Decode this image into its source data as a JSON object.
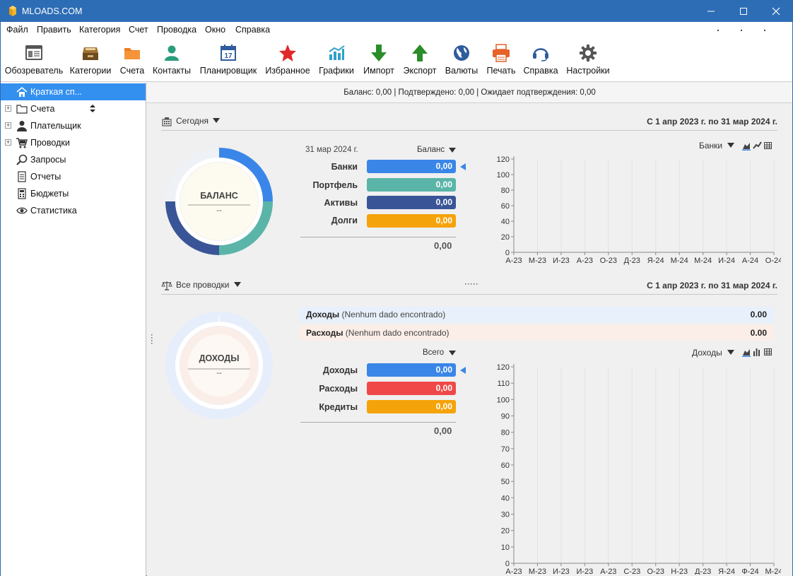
{
  "window": {
    "title": "MLOADS.COM"
  },
  "menu": [
    "Файл",
    "Править",
    "Категория",
    "Счет",
    "Проводка",
    "Окно",
    "Справка"
  ],
  "toolbar": [
    {
      "label": "Обозреватель",
      "icon": "browser-icon"
    },
    {
      "label": "Категории",
      "icon": "categories-icon"
    },
    {
      "label": "Счета",
      "icon": "folder-icon"
    },
    {
      "label": "Контакты",
      "icon": "contacts-icon"
    },
    {
      "label": "Планировщик",
      "icon": "calendar-icon"
    },
    {
      "label": "Избранное",
      "icon": "star-icon"
    },
    {
      "label": "Графики",
      "icon": "chart-icon"
    },
    {
      "label": "Импорт",
      "icon": "import-arrow-icon"
    },
    {
      "label": "Экспорт",
      "icon": "export-arrow-icon"
    },
    {
      "label": "Валюты",
      "icon": "globe-icon"
    },
    {
      "label": "Печать",
      "icon": "printer-icon"
    },
    {
      "label": "Справка",
      "icon": "headset-icon"
    },
    {
      "label": "Настройки",
      "icon": "gear-icon"
    }
  ],
  "sidebar": {
    "items": [
      {
        "label": "Краткая сп...",
        "icon": "home-icon",
        "active": true
      },
      {
        "label": "Счета",
        "icon": "folder-icon"
      },
      {
        "label": "Плательщик",
        "icon": "person-icon"
      },
      {
        "label": "Проводки",
        "icon": "cart-icon"
      },
      {
        "label": "Запросы",
        "icon": "search-icon"
      },
      {
        "label": "Отчеты",
        "icon": "report-icon"
      },
      {
        "label": "Бюджеты",
        "icon": "calculator-icon"
      },
      {
        "label": "Статистика",
        "icon": "eye-icon"
      }
    ]
  },
  "status": "Баланс: 0,00 | Подтверждено: 0,00 | Ожидает подтверждения: 0,00",
  "balance_section": {
    "dropdown_label": "Сегодня",
    "range": "С 1 апр 2023 г. по 31 мар 2024 г.",
    "date": "31 мар 2024 г.",
    "mode_label": "Баланс",
    "ring_title": "БАЛАНС",
    "ring_sub": "--",
    "rows": [
      {
        "label": "Банки",
        "value": "0,00",
        "color": "#3a86e8"
      },
      {
        "label": "Портфель",
        "value": "0,00",
        "color": "#5ab5a8"
      },
      {
        "label": "Активы",
        "value": "0,00",
        "color": "#3a5597"
      },
      {
        "label": "Долги",
        "value": "0,00",
        "color": "#f5a30a"
      }
    ],
    "total": "0,00",
    "chart_select": "Банки"
  },
  "transactions_section": {
    "dropdown_label": "Все проводки",
    "range": "С 1 апр 2023 г. по 31 мар 2024 г.",
    "income_row": {
      "label": "Доходы",
      "note": "(Nenhum dado encontrado)",
      "value": "0.00"
    },
    "expense_row": {
      "label": "Расходы",
      "note": "(Nenhum dado encontrado)",
      "value": "0.00"
    },
    "mode_label": "Всего",
    "ring_title": "ДОХОДЫ",
    "ring_sub": "--",
    "rows": [
      {
        "label": "Доходы",
        "value": "0,00",
        "color": "#3a86e8"
      },
      {
        "label": "Расходы",
        "value": "0,00",
        "color": "#f04848"
      },
      {
        "label": "Кредиты",
        "value": "0,00",
        "color": "#f5a30a"
      }
    ],
    "total": "0,00",
    "chart_select": "Доходы"
  },
  "chart_data": [
    {
      "type": "area",
      "categories": [
        "А-23",
        "М-23",
        "И-23",
        "И-23",
        "А-23",
        "С-23",
        "О-23",
        "Н-23",
        "Д-23",
        "Я-24",
        "Ф-24",
        "М-24"
      ],
      "tick_labels": [
        "А-23",
        "М-23",
        "И-23",
        "А-23",
        "О-23",
        "Д-23",
        "Я-24",
        "М-24",
        "М-24",
        "И-24",
        "А-24",
        "О-24"
      ],
      "yticks": [
        0,
        20,
        40,
        60,
        80,
        100,
        120
      ],
      "ylim": [
        0,
        120
      ],
      "series": [],
      "grid": true
    },
    {
      "type": "bar",
      "categories": [
        "А-23",
        "М-23",
        "И-23",
        "И-23",
        "А-23",
        "С-23",
        "О-23",
        "Н-23",
        "Д-23",
        "Я-24",
        "Ф-24",
        "М-24"
      ],
      "yticks": [
        0,
        10,
        20,
        30,
        40,
        50,
        60,
        70,
        80,
        90,
        100,
        110,
        120
      ],
      "ylim": [
        0,
        120
      ],
      "series": [],
      "grid": true
    }
  ]
}
